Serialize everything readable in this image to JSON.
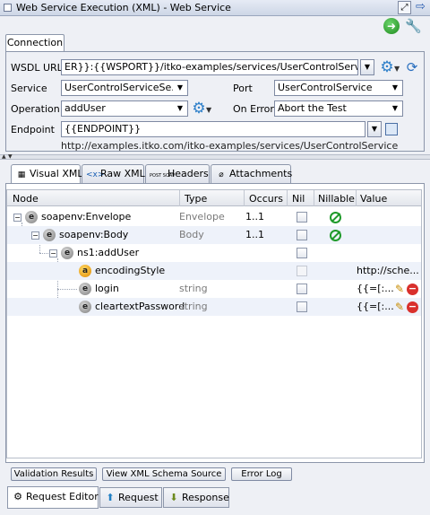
{
  "window": {
    "title": "Web Service Execution (XML) - Web Service"
  },
  "tabs": {
    "connection": "Connection"
  },
  "connection": {
    "wsdl_label": "WSDL URL",
    "wsdl_value": "ER}}:{{WSPORT}}/itko-examples/services/UserControlService?wsdl",
    "service_label": "Service",
    "service_value": "UserControlServiceSe...",
    "port_label": "Port",
    "port_value": "UserControlService",
    "operation_label": "Operation",
    "operation_value": "addUser",
    "on_error_label": "On Error",
    "on_error_value": "Abort the Test",
    "endpoint_label": "Endpoint",
    "endpoint_value": "{{ENDPOINT}}",
    "endpoint_url": "http://examples.itko.com/itko-examples/services/UserControlService"
  },
  "inner_tabs": {
    "visual_xml": "Visual XML",
    "raw_xml": "Raw XML",
    "soap_icon_text": "POST SOAP",
    "headers": "Headers",
    "attachments": "Attachments"
  },
  "table": {
    "headers": {
      "node": "Node",
      "type": "Type",
      "occurs": "Occurs",
      "nil": "Nil",
      "nillable": "Nillable",
      "value": "Value"
    },
    "rows": [
      {
        "icon": "e",
        "node": "soapenv:Envelope",
        "type": "Envelope",
        "occurs": "1..1",
        "value": ""
      },
      {
        "icon": "e",
        "node": "soapenv:Body",
        "type": "Body",
        "occurs": "1..1",
        "value": ""
      },
      {
        "icon": "e",
        "node": "ns1:addUser",
        "type": "",
        "occurs": "",
        "value": ""
      },
      {
        "icon": "a",
        "node": "encodingStyle",
        "type": "",
        "occurs": "",
        "value": "http://sche..."
      },
      {
        "icon": "e",
        "node": "login",
        "type": "string",
        "occurs": "",
        "value": "{{=[:..."
      },
      {
        "icon": "e",
        "node": "cleartextPassword",
        "type": "string",
        "occurs": "",
        "value": "{{=[:..."
      }
    ]
  },
  "buttons": {
    "validation": "Validation Results",
    "schema": "View XML Schema Source",
    "error_log": "Error Log"
  },
  "bottom_tabs": {
    "request_editor": "Request Editor",
    "request": "Request",
    "response": "Response"
  },
  "colors": {
    "accent": "#2d7fc9",
    "go": "#1d8a1d",
    "remove": "#d9302c",
    "nillable": "#1f9a2a"
  }
}
